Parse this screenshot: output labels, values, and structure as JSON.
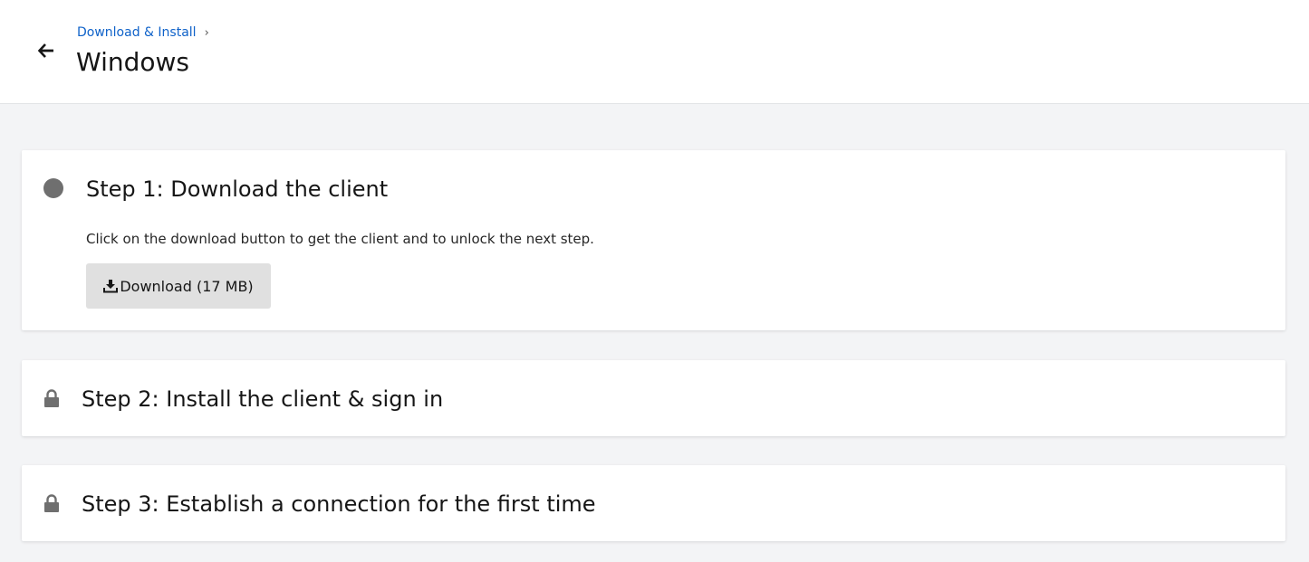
{
  "header": {
    "breadcrumb": "Download & Install",
    "breadcrumb_sep": "›",
    "title": "Windows"
  },
  "steps": [
    {
      "title": "Step 1: Download the client",
      "description": "Click on the download button to get the client and to unlock the next step.",
      "button_label": "Download (17 MB)",
      "status": "active"
    },
    {
      "title": "Step 2: Install the client & sign in",
      "status": "locked"
    },
    {
      "title": "Step 3: Establish a connection for the first time",
      "status": "locked"
    }
  ],
  "icons": {
    "back": "arrow-left-icon",
    "step_active": "status-dot-icon",
    "step_locked": "lock-icon",
    "download": "download-icon"
  },
  "colors": {
    "link": "#0f62c9",
    "background": "#f3f4f6",
    "button": "#e0e0e0",
    "icon_gray": "#6f6f6f"
  }
}
